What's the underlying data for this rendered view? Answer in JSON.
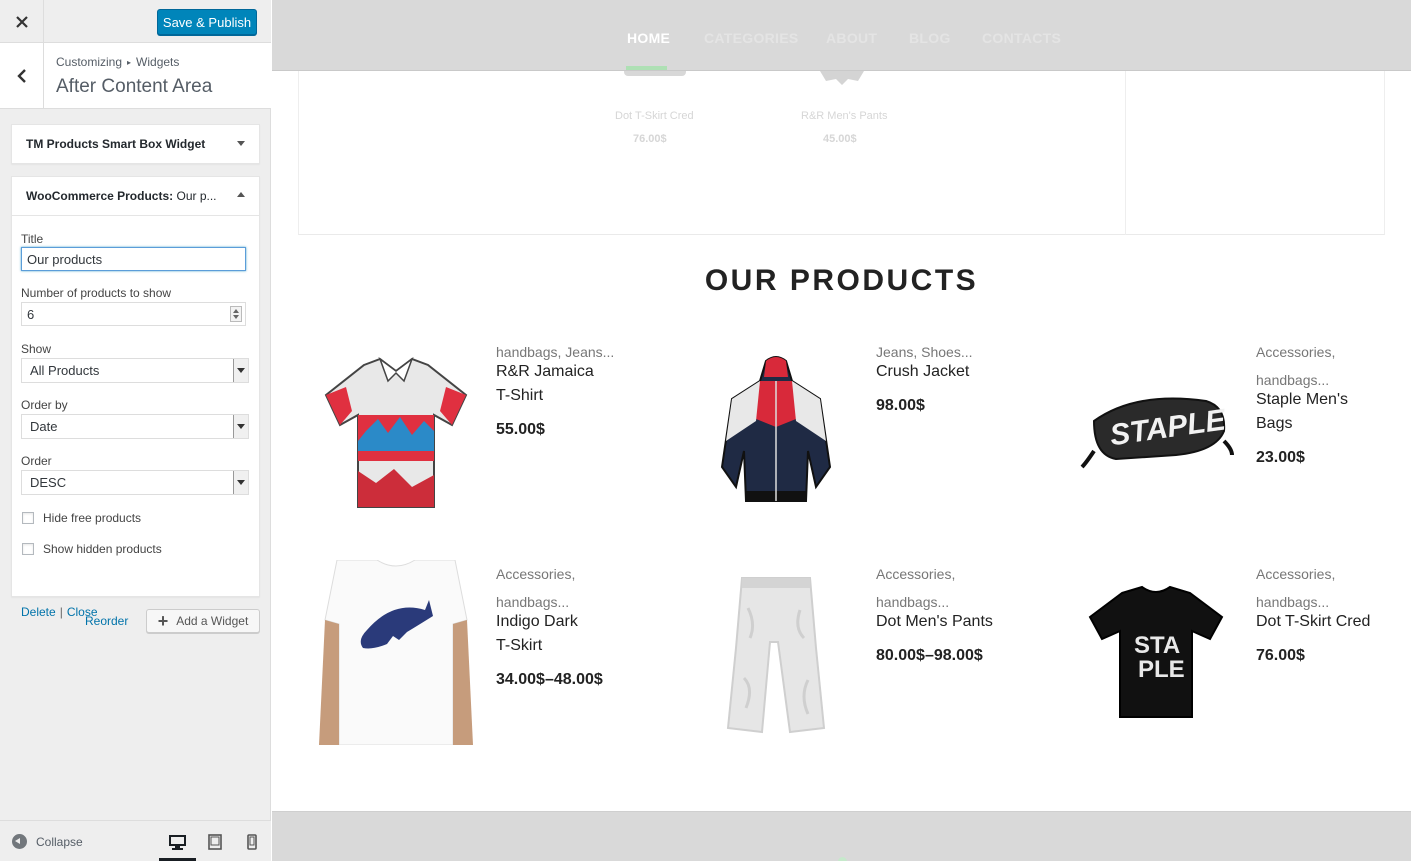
{
  "customizer": {
    "publish_label": "Save & Publish",
    "breadcrumb": [
      "Customizing",
      "Widgets"
    ],
    "section_title": "After Content Area",
    "widgets": [
      {
        "name": "TM Products Smart Box Widget"
      },
      {
        "name": "WooCommerce Products:",
        "title_suffix": "Our p..."
      }
    ],
    "form": {
      "title_label": "Title",
      "title_value": "Our products",
      "number_label": "Number of products to show",
      "number_value": "6",
      "show_label": "Show",
      "show_value": "All Products",
      "orderby_label": "Order by",
      "orderby_value": "Date",
      "order_label": "Order",
      "order_value": "DESC",
      "hide_free_label": "Hide free products",
      "show_hidden_label": "Show hidden products",
      "delete_label": "Delete",
      "link_separator": "|",
      "close_label": "Close"
    },
    "reorder_label": "Reorder",
    "add_widget_label": "Add a Widget",
    "collapse_label": "Collapse",
    "devices": [
      "desktop-icon",
      "tablet-icon",
      "mobile-icon"
    ]
  },
  "preview": {
    "nav": [
      "HOME",
      "CATEGORIES",
      "ABOUT",
      "BLOG",
      "CONTACTS"
    ],
    "previous_products": [
      {
        "name": "Dot T-Skirt Cred",
        "price": "76.00$"
      },
      {
        "name": "R&R Men's Pants",
        "price": "45.00$"
      }
    ],
    "heading": "OUR PRODUCTS",
    "products": [
      {
        "cats_line1": "handbags, Jeans...",
        "cats_line2": "",
        "name_line1": "R&R Jamaica",
        "name_line2": "T-Shirt",
        "price": "55.00$"
      },
      {
        "cats_line1": "Jeans, Shoes...",
        "cats_line2": "",
        "name_line1": "Crush Jacket",
        "name_line2": "",
        "price": "98.00$"
      },
      {
        "cats_line1": "Accessories,",
        "cats_line2": "handbags...",
        "name_line1": "Staple Men's",
        "name_line2": "Bags",
        "price": "23.00$"
      },
      {
        "cats_line1": "Accessories,",
        "cats_line2": "handbags...",
        "name_line1": "Indigo Dark",
        "name_line2": "T-Skirt",
        "price": "34.00$–48.00$"
      },
      {
        "cats_line1": "Accessories,",
        "cats_line2": "handbags...",
        "name_line1": "Dot Men's Pants",
        "name_line2": "",
        "price": "80.00$–98.00$"
      },
      {
        "cats_line1": "Accessories,",
        "cats_line2": "handbags...",
        "name_line1": "Dot T-Skirt Cred",
        "name_line2": "",
        "price": "76.00$"
      }
    ]
  },
  "colors": {
    "publish_blue": "#0085ba",
    "link_blue": "#0073aa",
    "nav_bg": "#d9d9d9",
    "nav_active_underline": "#aee0b4"
  }
}
